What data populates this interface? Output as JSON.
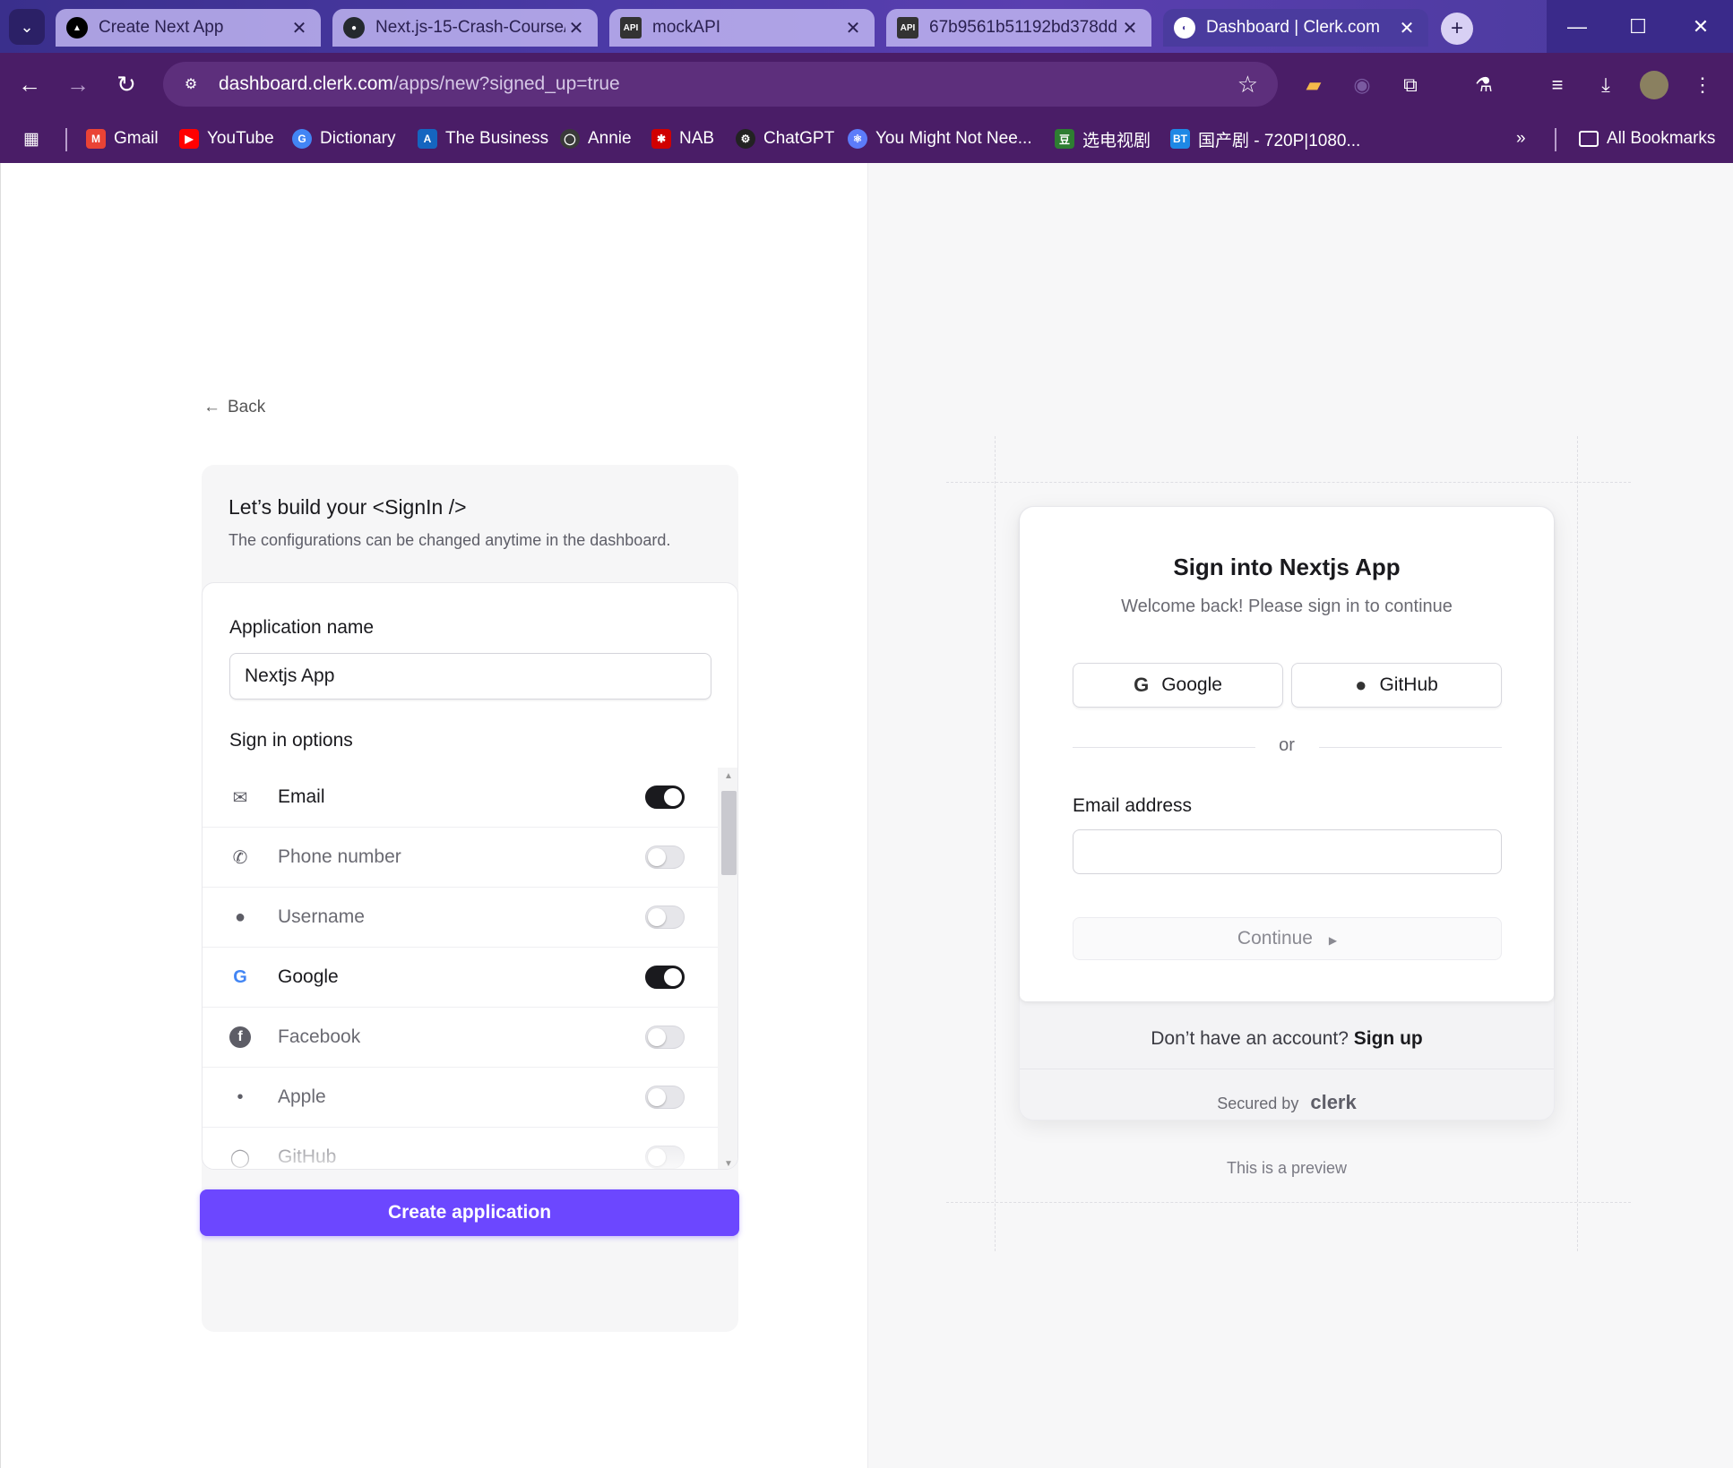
{
  "browser": {
    "tabs": [
      {
        "title": "Create Next App",
        "icon": "nextjs-icon"
      },
      {
        "title": "Next.js-15-Crash-Course/",
        "icon": "github-icon"
      },
      {
        "title": "mockAPI",
        "icon": "mockapi-icon"
      },
      {
        "title": "67b9561b51192bd378dd",
        "icon": "mockapi-icon"
      },
      {
        "title": "Dashboard | Clerk.com",
        "icon": "clerk-icon",
        "active": true
      }
    ],
    "url_host": "dashboard.clerk.com",
    "url_path": "/apps/new?signed_up=true",
    "bookmarks": [
      {
        "label": "Gmail",
        "color": "#ea4335",
        "glyph": "M"
      },
      {
        "label": "YouTube",
        "color": "#ff0000",
        "glyph": "▶"
      },
      {
        "label": "Dictionary",
        "color": "#4285f4",
        "glyph": "G"
      },
      {
        "label": "The Business",
        "color": "#1565c0",
        "glyph": "A"
      },
      {
        "label": "Annie",
        "color": "#3a3a3a",
        "glyph": "◯"
      },
      {
        "label": "NAB",
        "color": "#d00000",
        "glyph": "✱"
      },
      {
        "label": "ChatGPT",
        "color": "#222222",
        "glyph": "⚙"
      },
      {
        "label": "You Might Not Nee...",
        "color": "#5c7cfa",
        "glyph": "⚛"
      },
      {
        "label": "选电视剧",
        "color": "#2e7d32",
        "glyph": "豆"
      },
      {
        "label": "国产剧 - 720P|1080...",
        "color": "#1e88e5",
        "glyph": "BT"
      }
    ],
    "all_bookmarks": "All Bookmarks",
    "overflow": "»"
  },
  "builder": {
    "back": "Back",
    "heading": "Let’s build your <SignIn />",
    "subheading": "The configurations can be changed anytime in the dashboard.",
    "app_name_label": "Application name",
    "app_name_value": "Nextjs App",
    "sign_in_options_label": "Sign in options",
    "options": [
      {
        "label": "Email",
        "icon": "envelope-icon",
        "on": true
      },
      {
        "label": "Phone number",
        "icon": "phone-icon",
        "on": false
      },
      {
        "label": "Username",
        "icon": "user-circle-icon",
        "on": false
      },
      {
        "label": "Google",
        "icon": "google-icon",
        "on": true
      },
      {
        "label": "Facebook",
        "icon": "facebook-icon",
        "on": false
      },
      {
        "label": "Apple",
        "icon": "apple-icon",
        "on": false
      },
      {
        "label": "GitHub",
        "icon": "github-icon",
        "on": false
      }
    ],
    "create_button": "Create application"
  },
  "preview": {
    "title": "Sign into Nextjs App",
    "subtitle": "Welcome back! Please sign in to continue",
    "google_button": "Google",
    "github_button": "GitHub",
    "or": "or",
    "email_label": "Email address",
    "continue_button": "Continue",
    "no_account": "Don’t have an account?",
    "sign_up": "Sign up",
    "secured_by": "Secured by",
    "clerk_logo_text": "clerk",
    "preview_note": "This is a preview"
  },
  "colors": {
    "accent": "#6c47ff",
    "toolbar": "#4a1d67",
    "toggle_on": "#1a1a1e"
  }
}
